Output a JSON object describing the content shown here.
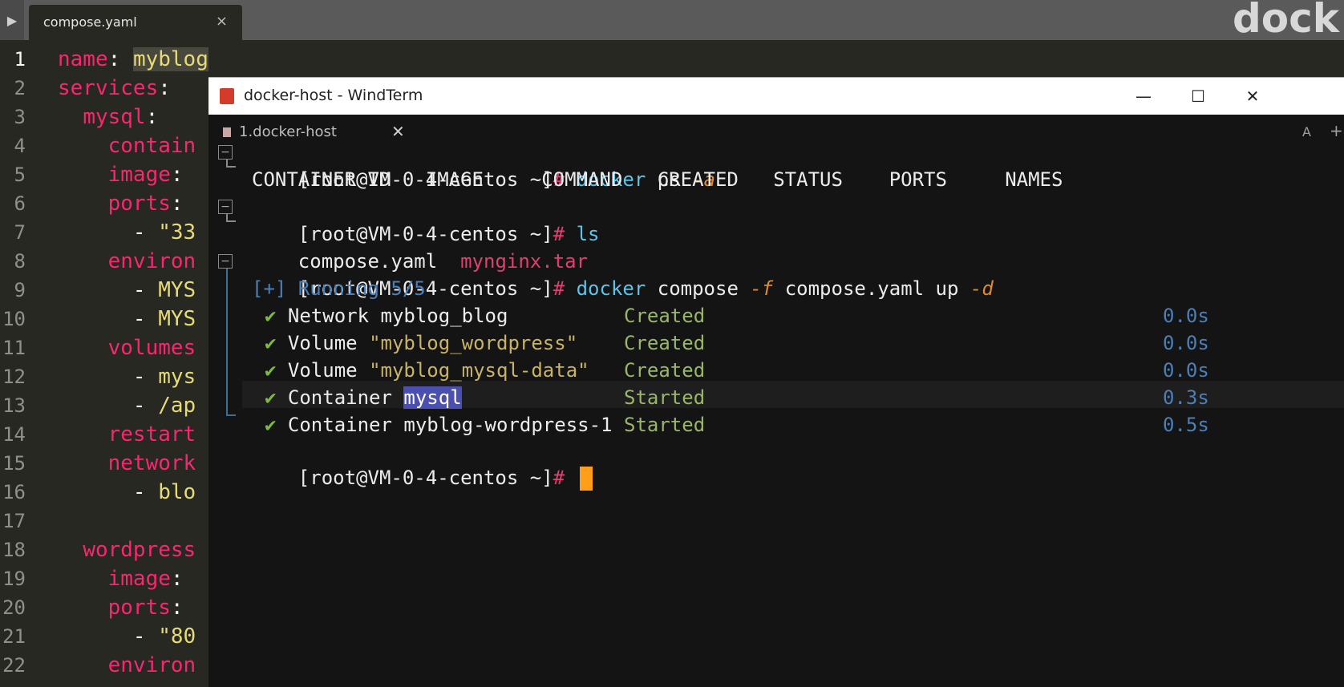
{
  "editor": {
    "tab_title": "compose.yaml",
    "tab_close": "×",
    "play": "▶",
    "brand": "dock",
    "line_numbers": [
      "1",
      "2",
      "3",
      "4",
      "5",
      "6",
      "7",
      "8",
      "9",
      "10",
      "11",
      "12",
      "13",
      "14",
      "15",
      "16",
      "17",
      "18",
      "19",
      "20",
      "21",
      "22"
    ],
    "lines": [
      {
        "indent": "",
        "key": "name",
        "sep": ": ",
        "val": "myblog"
      },
      {
        "indent": "",
        "key": "services",
        "sep": ":",
        "val": ""
      },
      {
        "indent": "  ",
        "key": "mysql",
        "sep": ":",
        "val": ""
      },
      {
        "indent": "    ",
        "key": "contain",
        "sep": "",
        "val": ""
      },
      {
        "indent": "    ",
        "key": "image",
        "sep": ":",
        "val": ""
      },
      {
        "indent": "    ",
        "key": "ports",
        "sep": ":",
        "val": ""
      },
      {
        "indent": "      ",
        "key": "",
        "sep": "- ",
        "val": "\"33"
      },
      {
        "indent": "    ",
        "key": "environ",
        "sep": "",
        "val": ""
      },
      {
        "indent": "      ",
        "key": "",
        "sep": "- ",
        "val": "MYS"
      },
      {
        "indent": "      ",
        "key": "",
        "sep": "- ",
        "val": "MYS"
      },
      {
        "indent": "    ",
        "key": "volumes",
        "sep": "",
        "val": ""
      },
      {
        "indent": "      ",
        "key": "",
        "sep": "- ",
        "val": "mys"
      },
      {
        "indent": "      ",
        "key": "",
        "sep": "- ",
        "val": "/ap"
      },
      {
        "indent": "    ",
        "key": "restart",
        "sep": "",
        "val": ""
      },
      {
        "indent": "    ",
        "key": "network",
        "sep": "",
        "val": ""
      },
      {
        "indent": "      ",
        "key": "",
        "sep": "- ",
        "val": "blo"
      },
      {
        "indent": "",
        "key": "",
        "sep": "",
        "val": ""
      },
      {
        "indent": "  ",
        "key": "wordpress",
        "sep": "",
        "val": ""
      },
      {
        "indent": "    ",
        "key": "image",
        "sep": ":",
        "val": ""
      },
      {
        "indent": "    ",
        "key": "ports",
        "sep": ":",
        "val": ""
      },
      {
        "indent": "      ",
        "key": "",
        "sep": "- ",
        "val": "\"80"
      },
      {
        "indent": "    ",
        "key": "environ",
        "sep": "",
        "val": ""
      }
    ]
  },
  "window": {
    "title": "docker-host - WindTerm",
    "minimize": "—",
    "maximize": "☐",
    "close": "✕"
  },
  "session_tab": {
    "label": "1.docker-host",
    "close": "✕",
    "a_button": "A",
    "plus_button": "+"
  },
  "terminal": {
    "prompt": "[root@VM-0-4-centos ~]",
    "hash": "#",
    "cmd1": {
      "cmd": "docker",
      "args": " ps ",
      "opt": "-a"
    },
    "ps_header": "CONTAINER ID   IMAGE     COMMAND   CREATED   STATUS    PORTS     NAMES",
    "cmd2": {
      "cmd": "ls"
    },
    "ls_output": {
      "file1": "compose.yaml",
      "file2": "mynginx.tar"
    },
    "cmd3": {
      "cmd": "docker",
      "args1": " compose ",
      "opt1": "-f",
      "args2": " compose.yaml up ",
      "opt2": "-d"
    },
    "running": "[+] Running 5/5",
    "check": "✔",
    "steps": [
      {
        "pre": "Network myblog_blog",
        "quoted": "",
        "status": "Created",
        "time": "0.0s"
      },
      {
        "pre": "Volume ",
        "quoted": "\"myblog_wordpress\"",
        "status": "Created",
        "time": "0.0s"
      },
      {
        "pre": "Volume ",
        "quoted": "\"myblog_mysql-data\"",
        "status": "Created",
        "time": "0.0s"
      },
      {
        "pre": "Container ",
        "selected": "mysql",
        "status": "Started",
        "time": "0.3s"
      },
      {
        "pre": "Container myblog-wordpress-1",
        "quoted": "",
        "status": "Started",
        "time": "0.5s"
      }
    ]
  },
  "colors": {
    "editor_bg": "#272822",
    "terminal_bg": "#141414",
    "cursor": "#ff9e18",
    "selection": "#4b4fb0"
  }
}
